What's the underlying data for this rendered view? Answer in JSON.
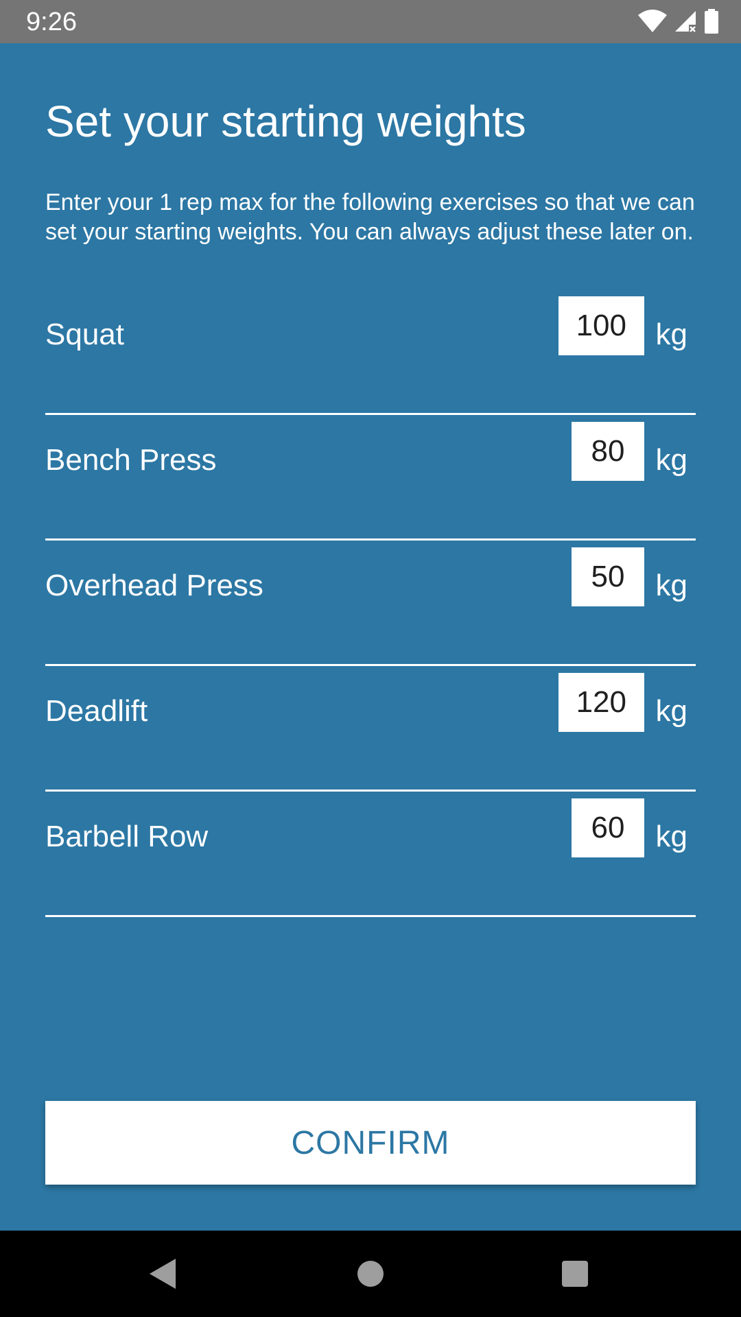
{
  "status_bar": {
    "time": "9:26",
    "icons": [
      "wifi-icon",
      "cell-signal-icon",
      "battery-icon"
    ]
  },
  "screen": {
    "title": "Set your starting weights",
    "description": "Enter your 1 rep max for the following exercises so that we can set your starting weights. You can always adjust these later on."
  },
  "exercises": [
    {
      "name": "Squat",
      "weight": "100",
      "unit": "kg"
    },
    {
      "name": "Bench Press",
      "weight": "80",
      "unit": "kg"
    },
    {
      "name": "Overhead Press",
      "weight": "50",
      "unit": "kg"
    },
    {
      "name": "Deadlift",
      "weight": "120",
      "unit": "kg"
    },
    {
      "name": "Barbell Row",
      "weight": "60",
      "unit": "kg"
    }
  ],
  "confirm_label": "CONFIRM",
  "nav_bar": {
    "icons": [
      "back-icon",
      "home-icon",
      "recents-icon"
    ]
  },
  "colors": {
    "background": "#2c77a4",
    "status_bar": "#757575",
    "nav_bar": "#000000",
    "button_text": "#2c77a4"
  }
}
